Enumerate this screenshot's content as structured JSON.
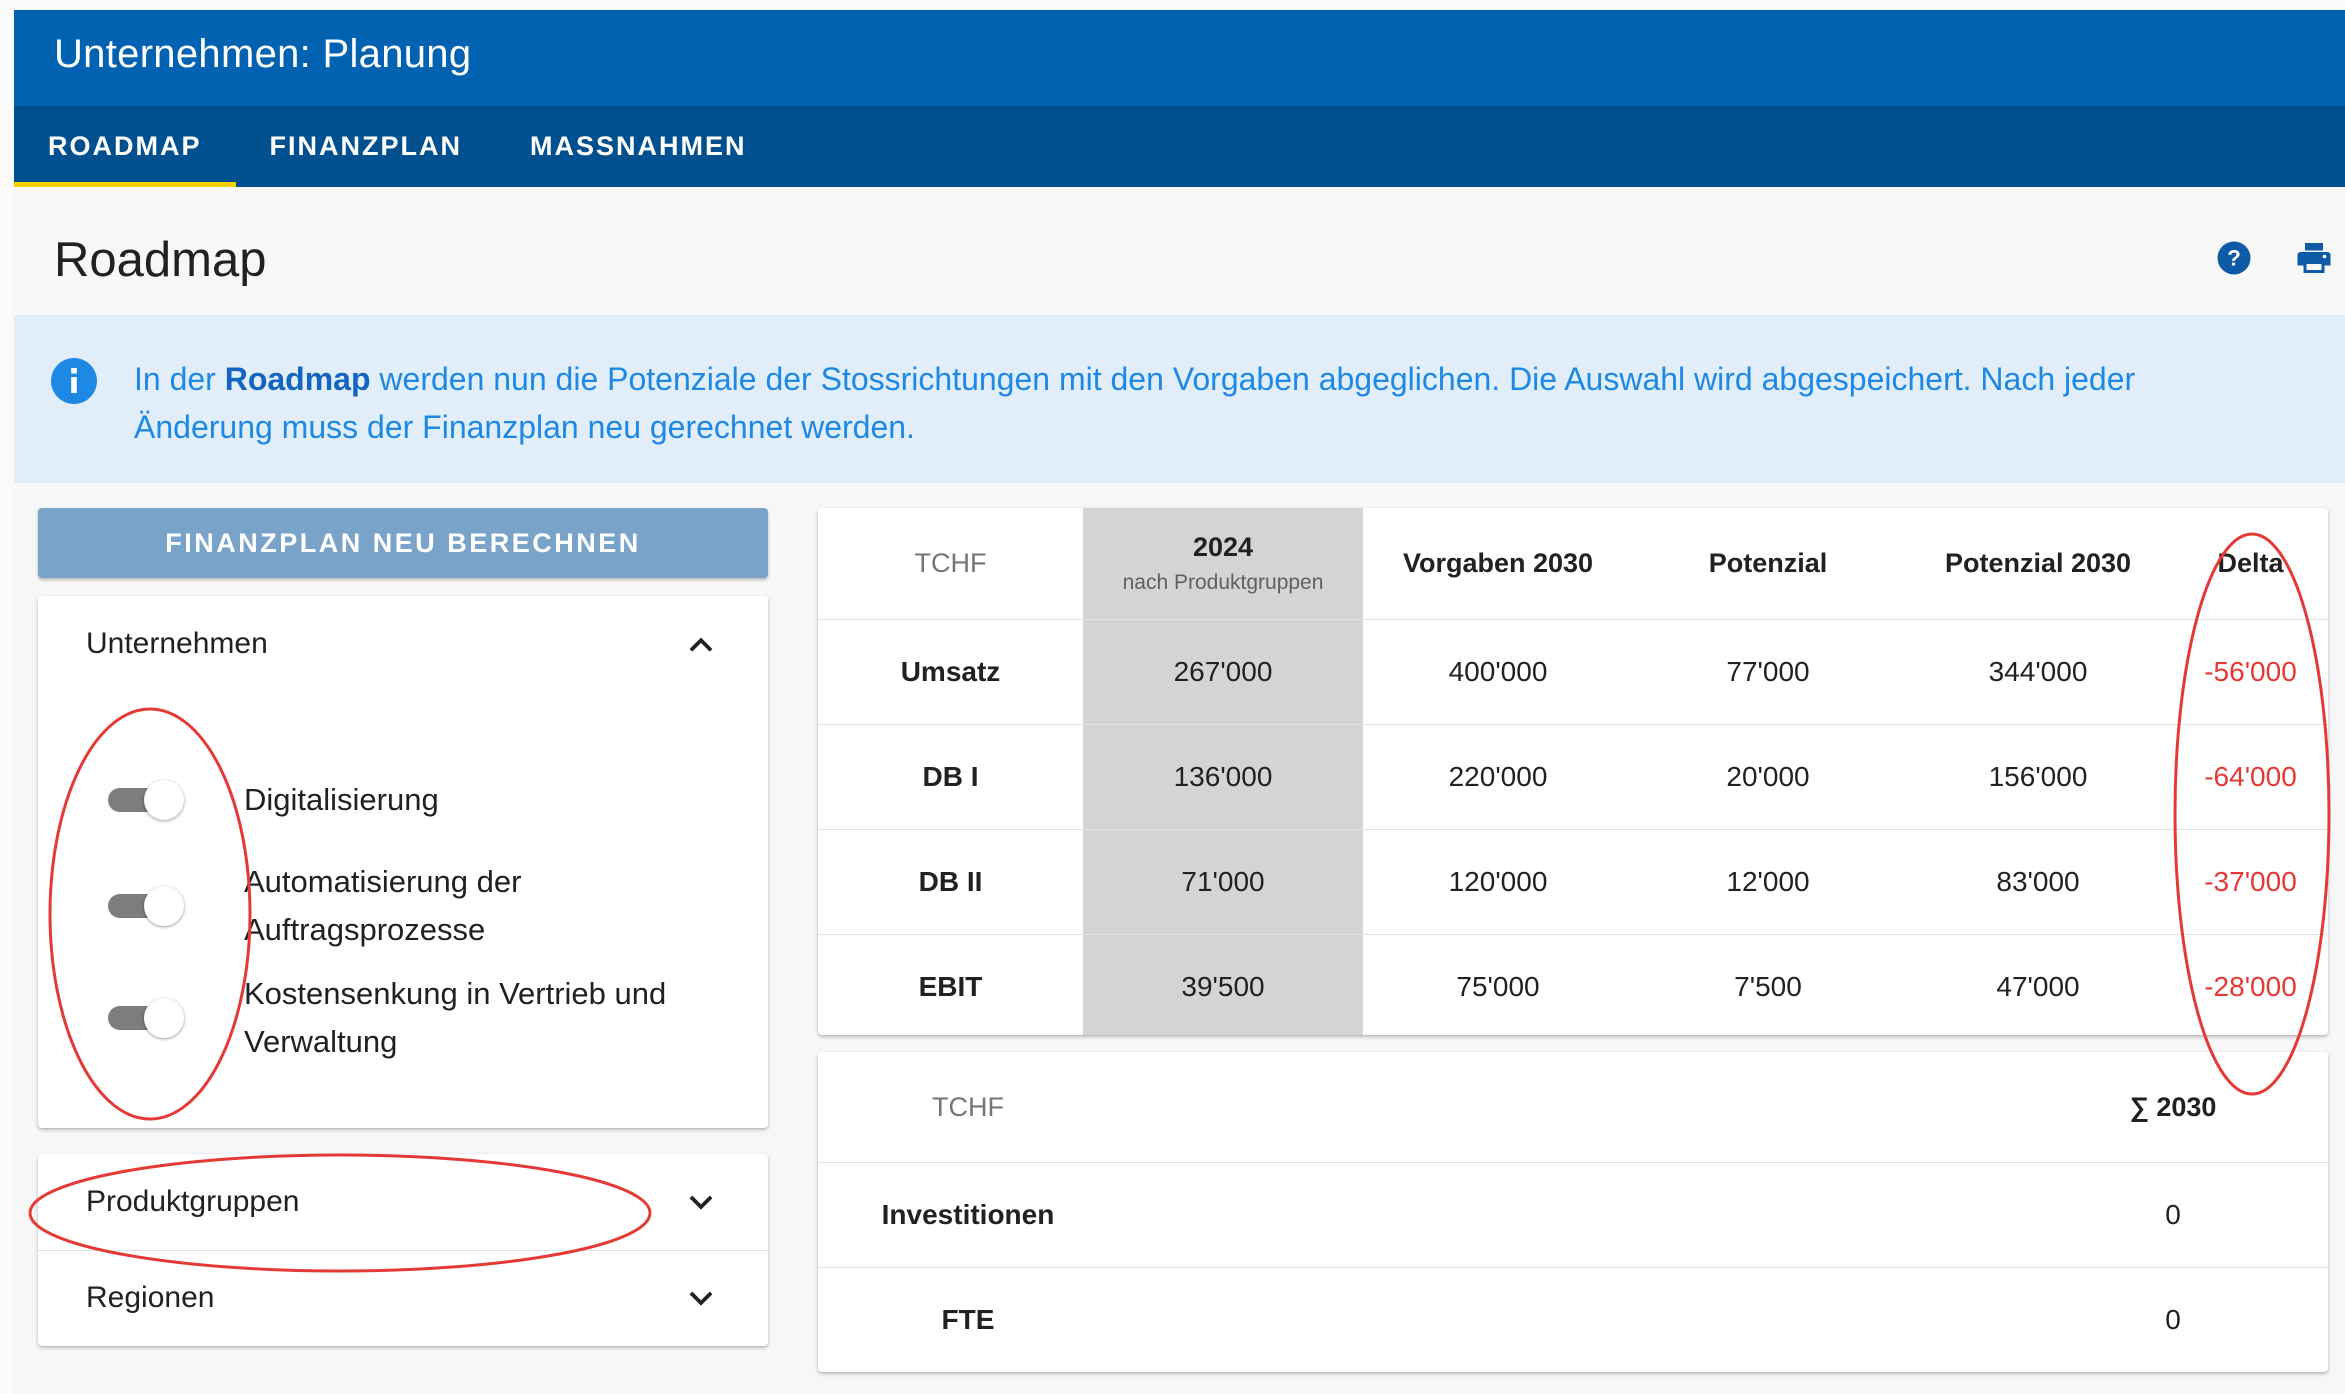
{
  "app": {
    "title": "Unternehmen: Planung"
  },
  "tabs": [
    {
      "label": "ROADMAP",
      "active": true
    },
    {
      "label": "FINANZPLAN",
      "active": false
    },
    {
      "label": "MASSNAHMEN",
      "active": false
    }
  ],
  "page": {
    "title": "Roadmap",
    "help_icon": "help-circle-icon",
    "print_icon": "printer-icon"
  },
  "info": {
    "icon": "info-circle-icon",
    "text_before": "In der ",
    "text_bold": "Roadmap",
    "text_after": " werden nun die Potenziale der Stossrichtungen mit den Vorgaben abgeglichen. Die Auswahl wird abgespeichert. Nach jeder Änderung muss der Finanzplan neu gerechnet werden."
  },
  "sidebar": {
    "recalc_button": "FINANZPLAN NEU BERECHNEN",
    "panels": [
      {
        "label": "Unternehmen",
        "expanded": true,
        "toggles": [
          {
            "label": "Digitalisierung",
            "on": false
          },
          {
            "label": "Automatisierung der Auftragsprozesse",
            "on": false
          },
          {
            "label": "Kostensenkung in Vertrieb und Verwaltung",
            "on": false
          }
        ]
      },
      {
        "label": "Produktgruppen",
        "expanded": false
      },
      {
        "label": "Regionen",
        "expanded": false
      }
    ]
  },
  "kpi_table": {
    "unit": "TCHF",
    "col_2024": "2024",
    "col_2024_sub": "nach Produktgruppen",
    "col_vorgaben": "Vorgaben 2030",
    "col_potenzial": "Potenzial",
    "col_potenzial2030": "Potenzial 2030",
    "col_delta": "Delta",
    "rows": [
      {
        "label": "Umsatz",
        "v2024": "267'000",
        "vorgaben": "400'000",
        "potenzial": "77'000",
        "potenzial2030": "344'000",
        "delta": "-56'000"
      },
      {
        "label": "DB I",
        "v2024": "136'000",
        "vorgaben": "220'000",
        "potenzial": "20'000",
        "potenzial2030": "156'000",
        "delta": "-64'000"
      },
      {
        "label": "DB II",
        "v2024": "71'000",
        "vorgaben": "120'000",
        "potenzial": "12'000",
        "potenzial2030": "83'000",
        "delta": "-37'000"
      },
      {
        "label": "EBIT",
        "v2024": "39'500",
        "vorgaben": "75'000",
        "potenzial": "7'500",
        "potenzial2030": "47'000",
        "delta": "-28'000"
      }
    ]
  },
  "sum_table": {
    "unit": "TCHF",
    "col_sum": "∑ 2030",
    "rows": [
      {
        "label": "Investitionen",
        "value": "0"
      },
      {
        "label": "FTE",
        "value": "0"
      }
    ]
  },
  "colors": {
    "header": "#0062b0",
    "tabbar": "#00508f",
    "tab_indicator": "#f5d000",
    "info_bg": "#e1eefa",
    "info_text": "#1e88e5",
    "button": "#7aa3c9",
    "negative": "#e53935",
    "annotation": "#e53935"
  }
}
